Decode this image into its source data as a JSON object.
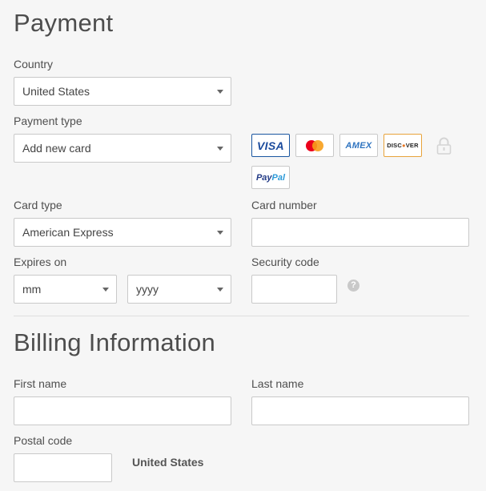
{
  "payment": {
    "title": "Payment",
    "country": {
      "label": "Country",
      "value": "United States"
    },
    "payment_type": {
      "label": "Payment type",
      "value": "Add new card"
    },
    "card_logos": [
      {
        "name": "visa",
        "text": "VISA"
      },
      {
        "name": "mastercard",
        "text": ""
      },
      {
        "name": "amex",
        "text": "AMEX"
      },
      {
        "name": "discover",
        "text_a": "DISC",
        "text_b": "VER"
      },
      {
        "name": "paypal",
        "text_a": "Pay",
        "text_b": "Pal"
      }
    ],
    "card_type": {
      "label": "Card type",
      "value": "American Express"
    },
    "card_number": {
      "label": "Card number",
      "value": ""
    },
    "expires_on": {
      "label": "Expires on",
      "month_value": "mm",
      "year_value": "yyyy"
    },
    "security_code": {
      "label": "Security code",
      "value": "",
      "help_glyph": "?"
    }
  },
  "billing": {
    "title": "Billing Information",
    "first_name": {
      "label": "First name",
      "value": ""
    },
    "last_name": {
      "label": "Last name",
      "value": ""
    },
    "postal_code": {
      "label": "Postal code",
      "value": ""
    },
    "country_text": "United States"
  },
  "colors": {
    "visa": "#1a4a9c",
    "mastercard_red": "#eb001b",
    "mastercard_orange": "#f79e1b",
    "amex": "#2f74c0",
    "discover_orange": "#e87722",
    "paypal_dark": "#233b86",
    "paypal_light": "#2d9ad8"
  }
}
